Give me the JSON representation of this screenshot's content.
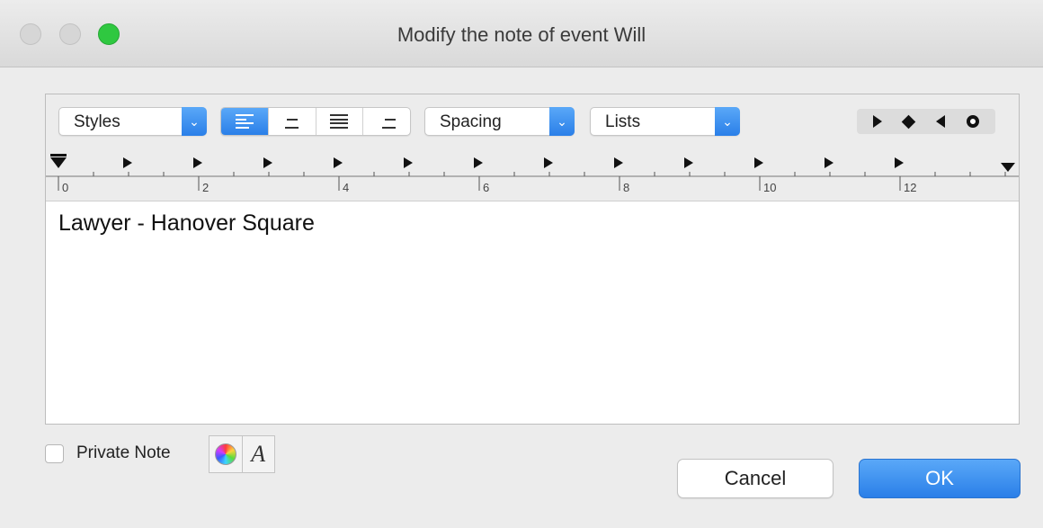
{
  "window": {
    "title": "Modify the note of event Will"
  },
  "toolbar": {
    "styles_label": "Styles",
    "spacing_label": "Spacing",
    "lists_label": "Lists",
    "alignment_active": "left",
    "dropdown_arrow": "⌄"
  },
  "ruler": {
    "labels": [
      "0",
      "2",
      "4",
      "6",
      "8",
      "10",
      "12"
    ]
  },
  "editor": {
    "text": "Lawyer -  Hanover Square"
  },
  "footer": {
    "private_note_label": "Private Note",
    "private_note_checked": false,
    "cancel_label": "Cancel",
    "ok_label": "OK",
    "font_button_glyph": "A"
  },
  "colors": {
    "accent": "#2a7fe8",
    "window_bg": "#ececec",
    "close_button": "#2fc840"
  }
}
